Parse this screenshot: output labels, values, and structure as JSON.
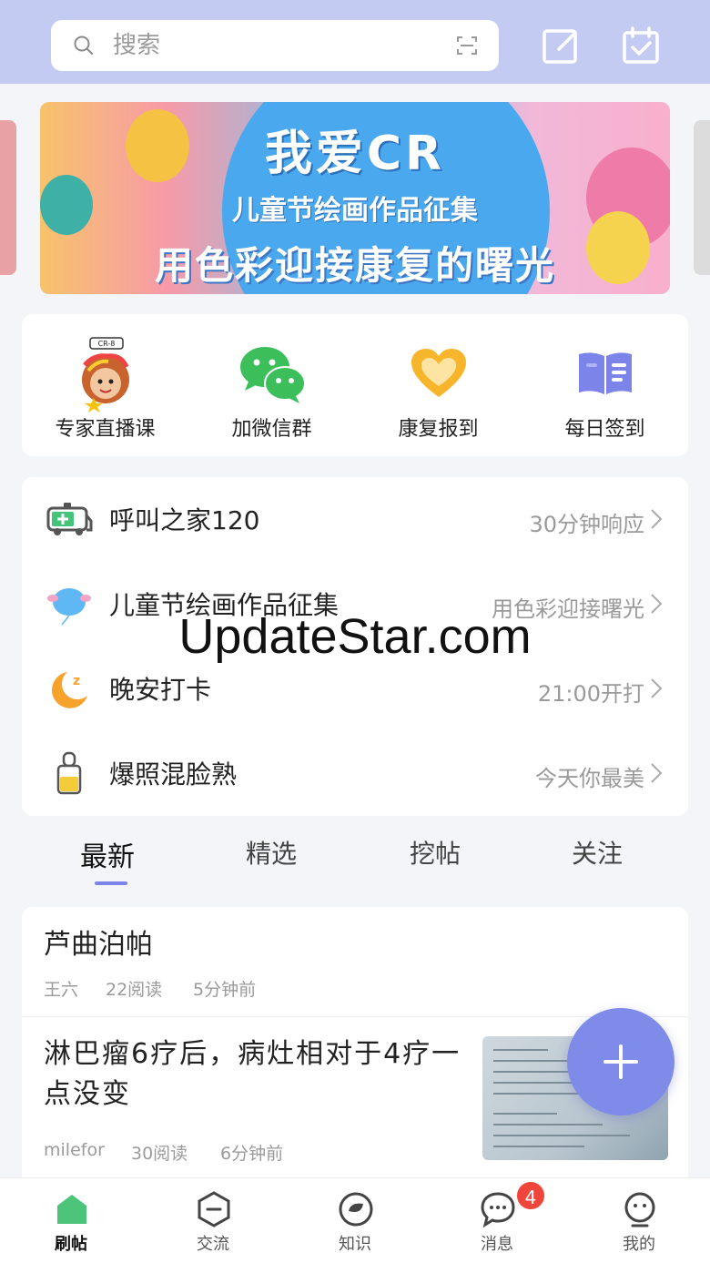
{
  "search": {
    "placeholder": "搜索"
  },
  "banner": {
    "title_line1": "我爱CR",
    "title_line2": "儿童节绘画作品征集",
    "title_line3": "用色彩迎接康复的曙光"
  },
  "shortcuts": [
    {
      "label": "专家直播课",
      "icon": "expert-live-icon"
    },
    {
      "label": "加微信群",
      "icon": "wechat-icon"
    },
    {
      "label": "康复报到",
      "icon": "heart-icon"
    },
    {
      "label": "每日签到",
      "icon": "book-icon"
    }
  ],
  "list": [
    {
      "title": "呼叫之家120",
      "subtitle": "30分钟响应",
      "icon": "ambulance-icon"
    },
    {
      "title": "儿童节绘画作品征集",
      "subtitle": "用色彩迎接曙光",
      "icon": "balloon-icon"
    },
    {
      "title": "晚安打卡",
      "subtitle": "21:00开打",
      "icon": "moon-icon"
    },
    {
      "title": "爆照混脸熟",
      "subtitle": "今天你最美",
      "icon": "lipstick-icon"
    }
  ],
  "tabs": [
    "最新",
    "精选",
    "挖帖",
    "关注"
  ],
  "feed": [
    {
      "title": "芦曲泊帕",
      "author": "王六",
      "reads": "22阅读",
      "time": "5分钟前"
    },
    {
      "title": "淋巴瘤6疗后，病灶相对于4疗一点没变",
      "author": "milefor",
      "reads": "30阅读",
      "time": "6分钟前"
    }
  ],
  "bottom_nav": [
    {
      "label": "刷帖",
      "icon": "home-icon"
    },
    {
      "label": "交流",
      "icon": "chat-hex-icon"
    },
    {
      "label": "知识",
      "icon": "knowledge-icon"
    },
    {
      "label": "消息",
      "icon": "message-icon"
    },
    {
      "label": "我的",
      "icon": "profile-icon"
    }
  ],
  "message_badge": "4",
  "watermark": "UpdateStar.com",
  "colors": {
    "header": "#c3cbf3",
    "accent": "#7f8be9",
    "badge": "#f0453a",
    "home_icon": "#4cc479"
  }
}
